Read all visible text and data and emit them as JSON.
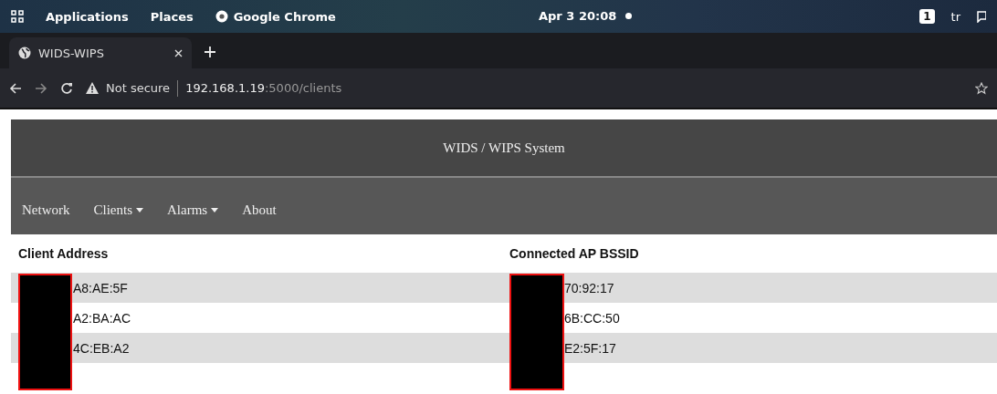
{
  "topbar": {
    "menus": [
      "Applications",
      "Places",
      "Google Chrome"
    ],
    "clock": "Apr 3 20:08",
    "workspace": "1",
    "keyboard": "tr"
  },
  "tabs": [
    {
      "label": "WIDS-WIPS",
      "selected": true
    }
  ],
  "address": {
    "security": "Not secure",
    "host": "192.168.1.19",
    "path": ":5000/clients"
  },
  "page": {
    "title": "WIDS / WIPS System",
    "nav": [
      {
        "label": "Network",
        "dropdown": false
      },
      {
        "label": "Clients",
        "dropdown": true
      },
      {
        "label": "Alarms",
        "dropdown": true
      },
      {
        "label": "About",
        "dropdown": false
      }
    ],
    "table": {
      "columns": [
        "Client Address",
        "Connected AP BSSID"
      ],
      "rows": [
        {
          "cells": [
            "A8:AE:5F",
            "70:92:17"
          ]
        },
        {
          "cells": [
            "A2:BA:AC",
            "6B:CC:50"
          ]
        },
        {
          "cells": [
            "4C:EB:A2",
            "E2:5F:17"
          ]
        }
      ]
    }
  }
}
